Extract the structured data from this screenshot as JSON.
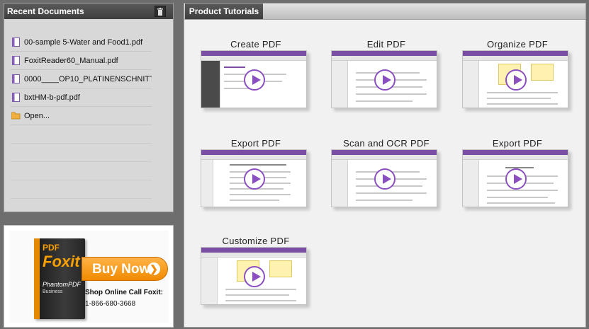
{
  "recent": {
    "title": "Recent Documents",
    "items": [
      {
        "label": "00-sample 5-Water and Food1.pdf",
        "icon": "pdf-file-icon"
      },
      {
        "label": "FoxitReader60_Manual.pdf",
        "icon": "pdf-file-icon"
      },
      {
        "label": "0000____OP10_PLATINENSCHNITT_...",
        "icon": "pdf-file-icon"
      },
      {
        "label": "bxtHM-b-pdf.pdf",
        "icon": "pdf-file-icon"
      },
      {
        "label": "Open...",
        "icon": "folder-icon"
      }
    ]
  },
  "ad": {
    "box_pdf": "PDF",
    "box_brand": "Foxit",
    "box_product": "PhantomPDF",
    "box_edition": "Business",
    "buy_label": "Buy Now",
    "shop_text": "Shop Online Call Foxit:",
    "phone": "1-866-680-3668"
  },
  "tutorials": {
    "tab_label": "Product Tutorials",
    "tiles": [
      {
        "title": "Create PDF"
      },
      {
        "title": "Edit PDF"
      },
      {
        "title": "Organize PDF"
      },
      {
        "title": "Export PDF"
      },
      {
        "title": "Scan and OCR PDF"
      },
      {
        "title": "Export PDF"
      },
      {
        "title": "Customize PDF"
      }
    ]
  },
  "colors": {
    "accent": "#8b4fc0",
    "header_dark": "#444444",
    "buy_orange": "#f18a00"
  }
}
